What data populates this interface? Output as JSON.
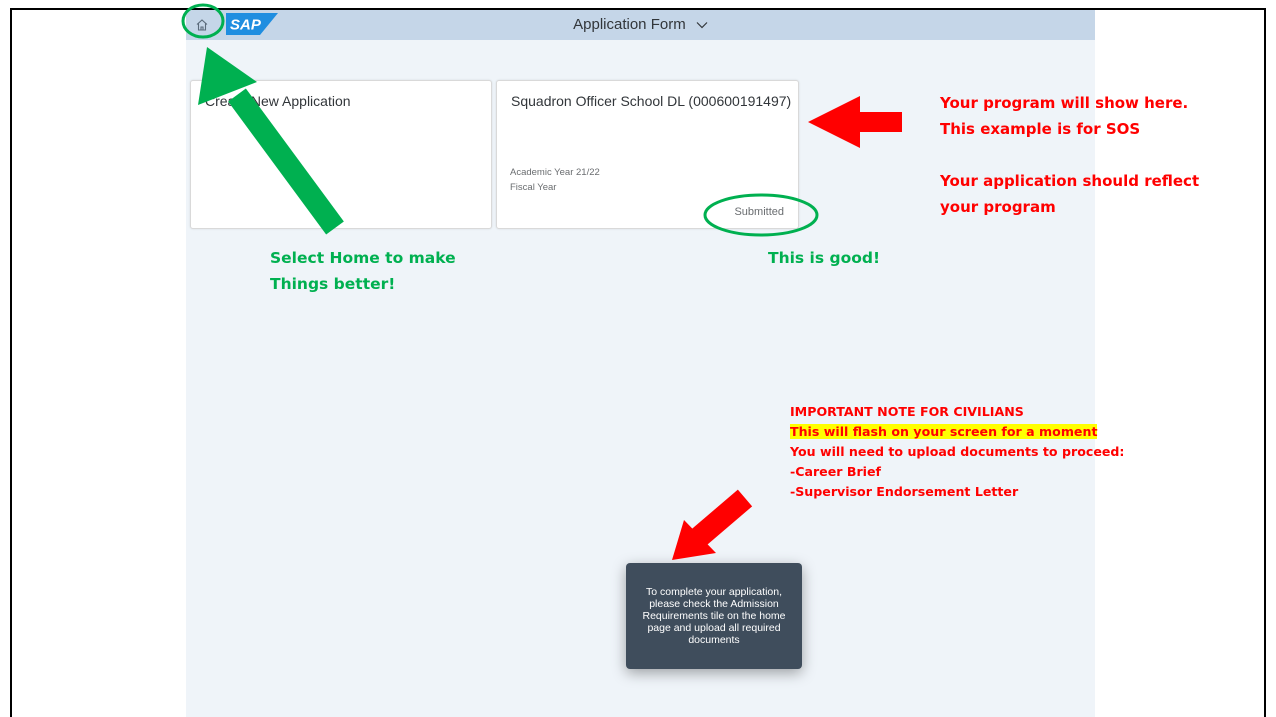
{
  "shell": {
    "home_icon": "home-icon",
    "logo_text": "SAP",
    "title": "Application Form",
    "chevron_icon": "chevron-down-icon"
  },
  "tiles": {
    "create": {
      "title": "Create New Application"
    },
    "program": {
      "title": "Squadron Officer School DL (000600191497)",
      "academic_year": "Academic Year 21/22",
      "fiscal_year": "Fiscal Year",
      "status": "Submitted"
    }
  },
  "toast": {
    "message": "To complete your application, please check the Admission Requirements tile on the home page and upload all required documents"
  },
  "annotations": {
    "program_note": [
      "Your program will show here.",
      "This example is for SOS",
      "",
      "Your application should reflect",
      "your program"
    ],
    "home_note": [
      "Select Home to make",
      "Things better!"
    ],
    "good_note": "This is good!",
    "important": {
      "heading": "IMPORTANT NOTE FOR CIVILIANS",
      "highlight": "This will flash on your screen for a moment",
      "line1": "You will need to upload documents to proceed:",
      "line2": "-Career Brief",
      "line3": "-Supervisor Endorsement Letter"
    }
  },
  "colors": {
    "shell_bar": "#c5d6e8",
    "app_bg": "#eff4f9",
    "toast_bg": "#3f4d5c",
    "annotation_red": "#ff0000",
    "annotation_green": "#00b050",
    "highlight": "#ffff00"
  }
}
